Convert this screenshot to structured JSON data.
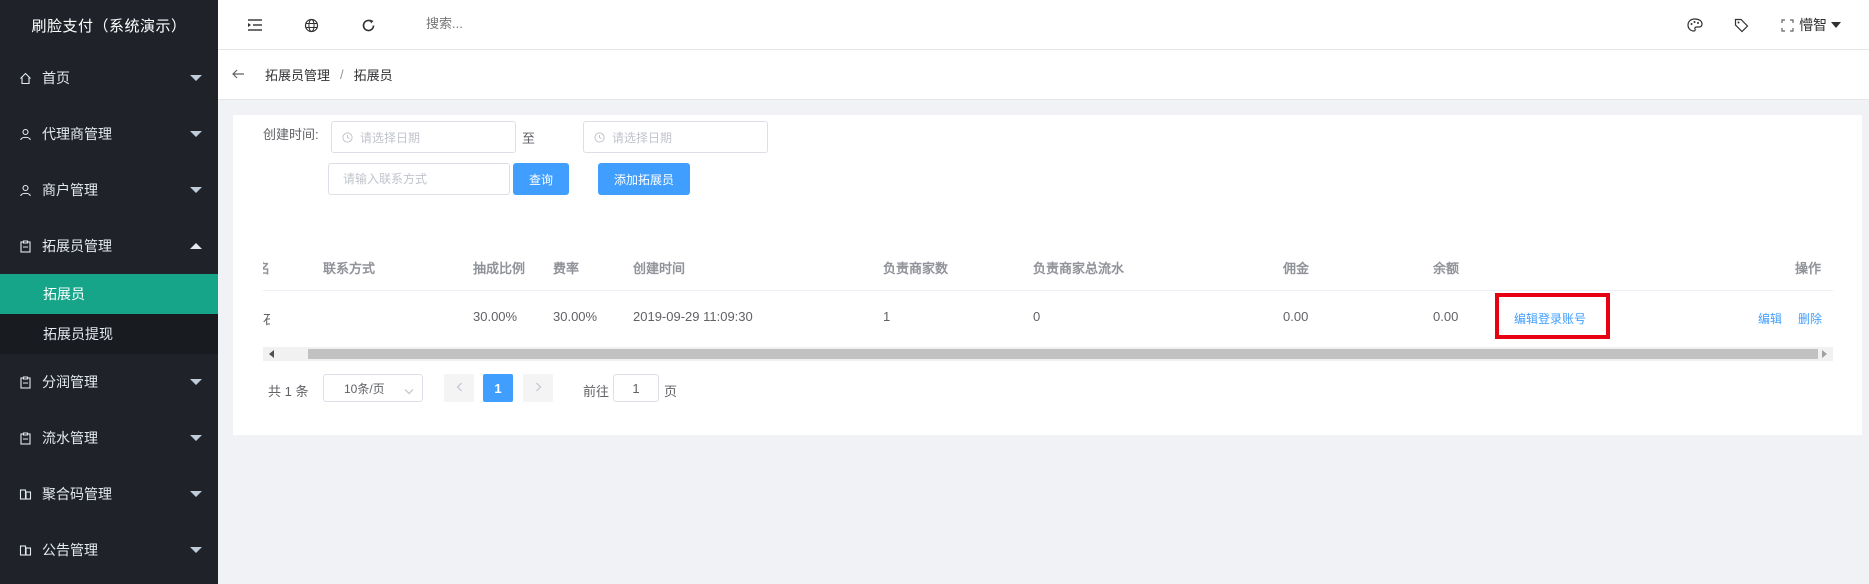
{
  "app": {
    "title": "刷脸支付（系统演示）"
  },
  "sidebar": {
    "items": [
      {
        "label": "首页",
        "icon": "home-icon",
        "expanded": false
      },
      {
        "label": "代理商管理",
        "icon": "user-icon",
        "expanded": false
      },
      {
        "label": "商户管理",
        "icon": "user-icon",
        "expanded": false
      },
      {
        "label": "拓展员管理",
        "icon": "clipboard-icon",
        "expanded": true,
        "children": [
          {
            "label": "拓展员",
            "active": true
          },
          {
            "label": "拓展员提现",
            "active": false
          }
        ]
      },
      {
        "label": "分润管理",
        "icon": "clipboard-icon",
        "expanded": false
      },
      {
        "label": "流水管理",
        "icon": "clipboard-icon",
        "expanded": false
      },
      {
        "label": "聚合码管理",
        "icon": "document-icon",
        "expanded": false
      },
      {
        "label": "公告管理",
        "icon": "document-icon",
        "expanded": false
      }
    ]
  },
  "header": {
    "search_placeholder": "搜索...",
    "user_name": "懵智",
    "icons": [
      "menu-fold-icon",
      "globe-icon",
      "refresh-icon",
      "palette-icon",
      "tag-icon",
      "fullscreen-icon"
    ]
  },
  "breadcrumb": {
    "parent": "拓展员管理",
    "separator": "/",
    "current": "拓展员"
  },
  "filters": {
    "create_time_label": "创建时间:",
    "start_date_placeholder": "请选择日期",
    "range_separator": "至",
    "end_date_placeholder": "请选择日期",
    "contact_placeholder": "请输入联系方式",
    "query_button": "查询",
    "add_button": "添加拓展员"
  },
  "table": {
    "columns": [
      "名",
      "联系方式",
      "抽成比例",
      "费率",
      "创建时间",
      "负责商家数",
      "负责商家总流水",
      "佣金",
      "余额",
      "操作"
    ],
    "rows": [
      {
        "name": "石",
        "contact": "",
        "commission_ratio": "30.00%",
        "rate": "30.00%",
        "created_at": "2019-09-29 11:09:30",
        "merchant_count": "1",
        "merchant_total_flow": "0",
        "commission": "0.00",
        "balance": "0.00",
        "edit_login_link": "编辑登录账号",
        "edit_link": "编辑",
        "delete_link": "删除"
      }
    ]
  },
  "pagination": {
    "total": "共 1 条",
    "page_size": "10条/页",
    "current_page": "1",
    "goto_prefix": "前往",
    "goto_value": "1",
    "goto_suffix": "页"
  },
  "colors": {
    "sidebar_bg": "#1f2329",
    "active_menu": "#17a589",
    "primary": "#409eff",
    "highlight": "#e60012"
  }
}
